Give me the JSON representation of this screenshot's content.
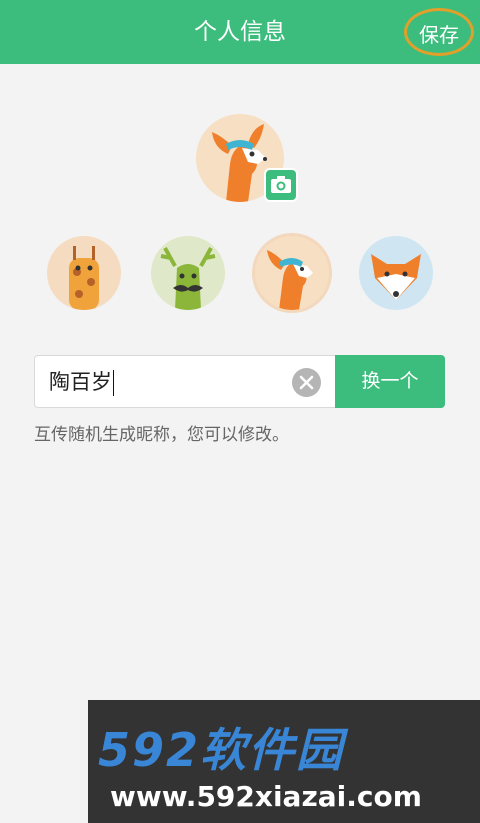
{
  "header": {
    "title": "个人信息",
    "save_label": "保存"
  },
  "avatars": [
    {
      "name": "giraffe-avatar",
      "selected": false
    },
    {
      "name": "deer-mustache-avatar",
      "selected": false
    },
    {
      "name": "fawn-headband-avatar",
      "selected": true
    },
    {
      "name": "fox-avatar",
      "selected": false
    }
  ],
  "nickname": {
    "value": "陶百岁"
  },
  "change_button": "换一个",
  "hint": "互传随机生成昵称，您可以修改。",
  "watermark": {
    "brand": "592软件园",
    "url": "www.592xiazai.com"
  },
  "colors": {
    "primary": "#3dbd7d",
    "highlight": "#e1a02b"
  }
}
